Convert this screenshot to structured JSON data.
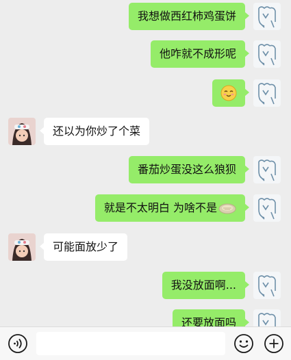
{
  "messages": [
    {
      "side": "right",
      "text": "我想做西红柿鸡蛋饼"
    },
    {
      "side": "right",
      "text": "他咋就不成形呢"
    },
    {
      "side": "right",
      "emoji": "smiling-face-emoji"
    },
    {
      "side": "left",
      "text": "还以为你炒了个菜"
    },
    {
      "side": "right",
      "text": "番茄炒蛋没这么狼狈"
    },
    {
      "side": "right",
      "text": "就是不太明白 为啥不是",
      "trailing_icon": "pancake-emoji"
    },
    {
      "side": "left",
      "text": "可能面放少了"
    },
    {
      "side": "right",
      "text": "我没放面啊..."
    },
    {
      "side": "right",
      "text": "还要放面吗"
    }
  ],
  "input_bar": {
    "input_value": "",
    "icons": [
      "voice-icon",
      "emoji-icon",
      "plus-icon"
    ]
  },
  "colors": {
    "background": "#ededed",
    "sent_bubble": "#95ec69",
    "received_bubble": "#ffffff"
  }
}
